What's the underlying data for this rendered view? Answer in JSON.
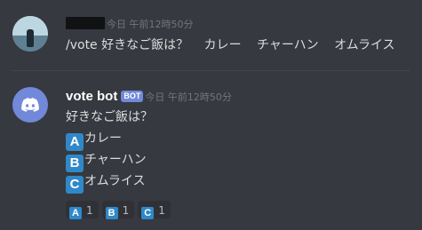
{
  "message1": {
    "timestamp": "今日 午前12時50分",
    "content_words": [
      "/vote 好きなご飯は？",
      "カレー",
      "チャーハン",
      "オムライス"
    ]
  },
  "message2": {
    "username": "vote bot",
    "bot_tag": "BOT",
    "timestamp": "今日 午前12時50分",
    "question": "好きなご飯は？",
    "options": [
      {
        "letter": "A",
        "text": "カレー"
      },
      {
        "letter": "B",
        "text": "チャーハン"
      },
      {
        "letter": "C",
        "text": "オムライス"
      }
    ],
    "reactions": [
      {
        "letter": "A",
        "count": "1"
      },
      {
        "letter": "B",
        "count": "1"
      },
      {
        "letter": "C",
        "count": "1"
      }
    ]
  },
  "colors": {
    "background": "#36393f",
    "bot_avatar": "#7289da",
    "letter_emoji": "#2f88c8",
    "reaction_bg": "#2f3136"
  },
  "icons": {
    "bot_avatar": "discord-logo-icon",
    "user_avatar": "user-photo-avatar",
    "letter_emoji": "regional-indicator-icon"
  }
}
